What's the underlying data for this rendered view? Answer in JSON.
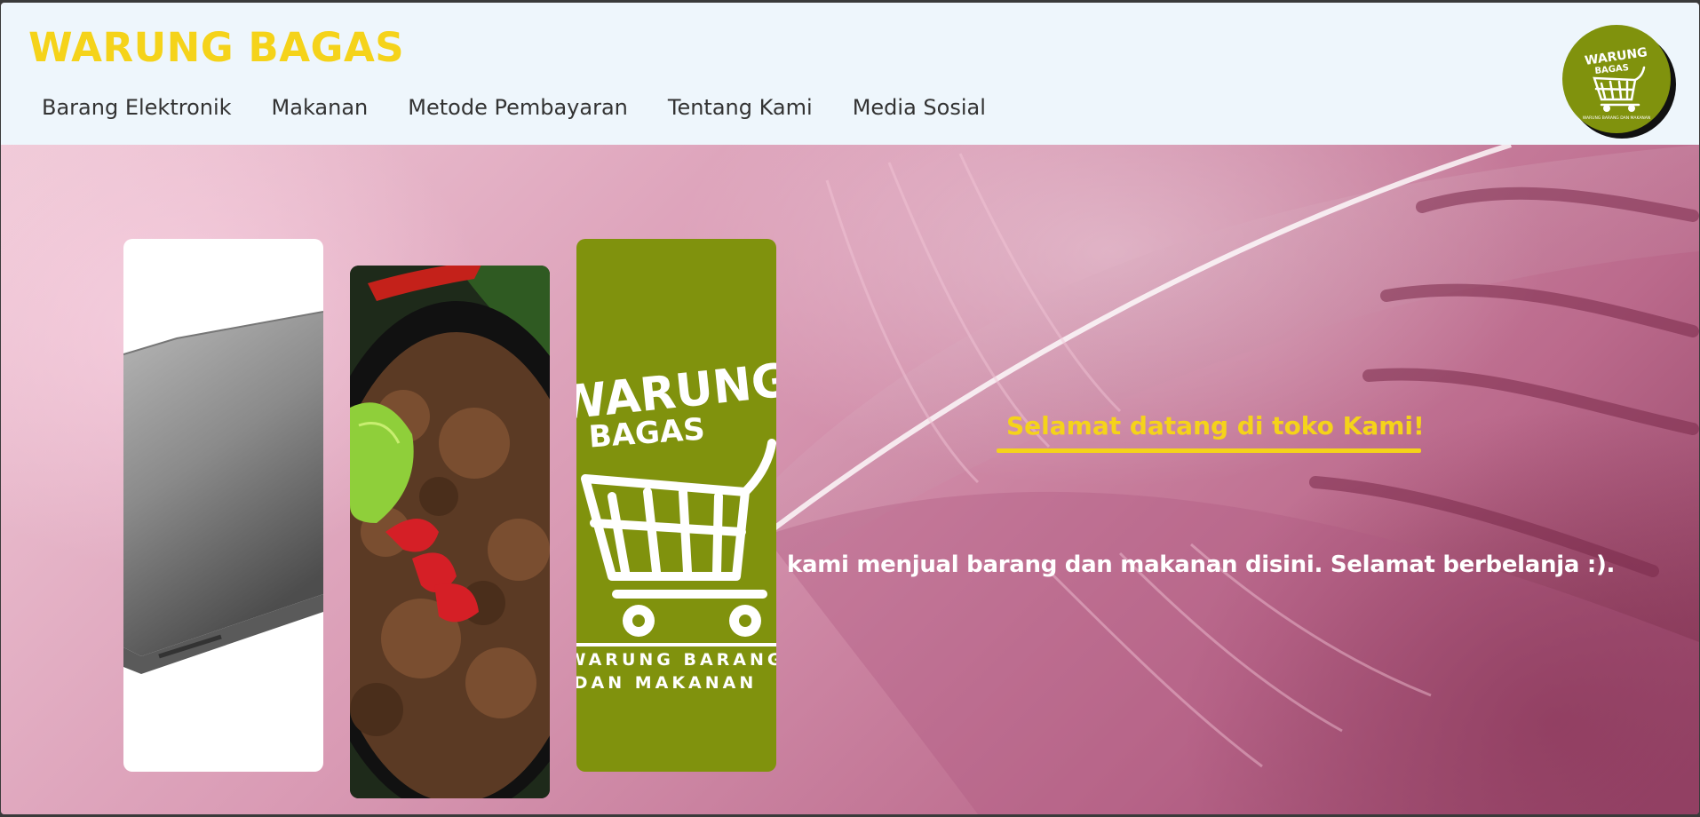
{
  "header": {
    "brand": "WARUNG BAGAS",
    "nav": [
      {
        "label": "Barang Elektronik"
      },
      {
        "label": "Makanan"
      },
      {
        "label": "Metode Pembayaran"
      },
      {
        "label": "Tentang Kami"
      },
      {
        "label": "Media Sosial"
      }
    ],
    "logo": {
      "line1": "WARUNG",
      "line2": "BAGAS",
      "tagline": "WARUNG BARANG DAN MAKANAN"
    }
  },
  "hero": {
    "cards": [
      {
        "subject": "laptop"
      },
      {
        "subject": "rendang food"
      },
      {
        "subject": "warung-bagas-logo",
        "line1": "WARUNG",
        "line2": "BAGAS",
        "tagline1": "WARUNG BARANG",
        "tagline2": "DAN MAKANAN"
      }
    ],
    "welcome_heading": "Selamat datang di toko Kami!",
    "welcome_text": "kami menjual barang dan makanan disini. Selamat berbelanja :)."
  },
  "colors": {
    "brand_yellow": "#f5d31a",
    "logo_green": "#80920d",
    "header_bg": "#eef6fc",
    "hero_pink": "#d99ab4"
  }
}
